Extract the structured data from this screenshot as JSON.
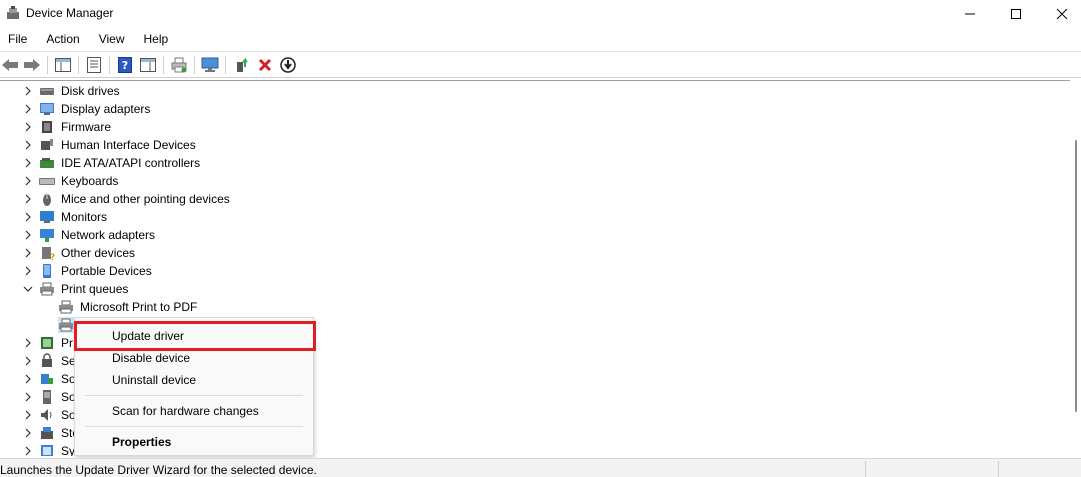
{
  "window": {
    "title": "Device Manager",
    "minimize_glyph": "—",
    "maximize_glyph": "☐",
    "close_glyph": "✕"
  },
  "menu": [
    "File",
    "Action",
    "View",
    "Help"
  ],
  "tree": {
    "categories": [
      {
        "label": "Disk drives",
        "icon": "disk-drive-icon"
      },
      {
        "label": "Display adapters",
        "icon": "display-adapter-icon"
      },
      {
        "label": "Firmware",
        "icon": "firmware-icon"
      },
      {
        "label": "Human Interface Devices",
        "icon": "hid-icon"
      },
      {
        "label": "IDE ATA/ATAPI controllers",
        "icon": "ide-controller-icon"
      },
      {
        "label": "Keyboards",
        "icon": "keyboard-icon"
      },
      {
        "label": "Mice and other pointing devices",
        "icon": "mouse-icon"
      },
      {
        "label": "Monitors",
        "icon": "monitor-icon"
      },
      {
        "label": "Network adapters",
        "icon": "network-adapter-icon"
      },
      {
        "label": "Other devices",
        "icon": "other-devices-icon"
      },
      {
        "label": "Portable Devices",
        "icon": "portable-device-icon"
      },
      {
        "label": "Print queues",
        "icon": "printer-icon",
        "expanded": true
      }
    ],
    "print_queue_children": [
      {
        "label": "Microsoft Print to PDF",
        "icon": "printer-icon"
      }
    ],
    "partial_rows": [
      {
        "label": "Pr",
        "icon": "processor-icon"
      },
      {
        "label": "Se",
        "icon": "security-device-icon"
      },
      {
        "label": "So",
        "icon": "software-component-icon"
      },
      {
        "label": "So",
        "icon": "software-device-icon"
      },
      {
        "label": "So",
        "icon": "sound-icon"
      },
      {
        "label": "Sto",
        "icon": "storage-controller-icon"
      },
      {
        "label": "Sy",
        "icon": "system-device-icon"
      }
    ]
  },
  "context_menu": {
    "update_driver": "Update driver",
    "disable_device": "Disable device",
    "uninstall_device": "Uninstall device",
    "scan_hardware": "Scan for hardware changes",
    "properties": "Properties",
    "highlight_color": "#e31b23"
  },
  "status_bar": {
    "text": "Launches the Update Driver Wizard for the selected device."
  }
}
